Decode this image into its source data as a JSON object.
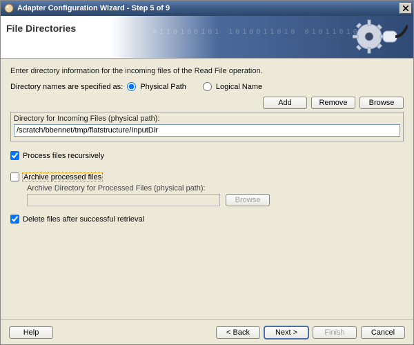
{
  "window": {
    "title": "Adapter Configuration Wizard - Step 5 of 9"
  },
  "banner": {
    "heading": "File Directories"
  },
  "intro": "Enter directory information for the incoming files of the Read File operation.",
  "dir_spec": {
    "label": "Directory names are specified as:",
    "physical": "Physical Path",
    "logical": "Logical Name",
    "selected": "physical"
  },
  "buttons": {
    "add": "Add",
    "remove": "Remove",
    "browse": "Browse",
    "browse2": "Browse"
  },
  "incoming": {
    "label": "Directory for Incoming Files (physical path):",
    "value": "/scratch/bbennet/tmp/flatstructure/InputDir"
  },
  "checks": {
    "recursive": {
      "label": "Process files recursively",
      "checked": true
    },
    "archive": {
      "label": "Archive processed files",
      "checked": false,
      "sub_label": "Archive Directory for Processed Files (physical path):",
      "value": ""
    },
    "delete": {
      "label": "Delete files after successful retrieval",
      "checked": true
    }
  },
  "footer": {
    "help": "Help",
    "back": "< Back",
    "next": "Next >",
    "finish": "Finish",
    "cancel": "Cancel"
  }
}
